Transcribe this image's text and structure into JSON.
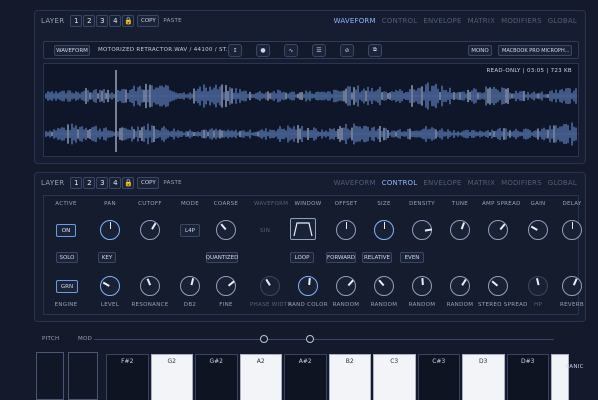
{
  "layer_label": "LAYER",
  "layer_numbers": [
    "1",
    "2",
    "3",
    "4"
  ],
  "copy_label": "COPY",
  "paste_label": "PASTE",
  "tabs": [
    "WAVEFORM",
    "CONTROL",
    "ENVELOPE",
    "MATRIX",
    "MODIFIERS",
    "GLOBAL"
  ],
  "waveform": {
    "button": "WAVEFORM",
    "file": "MOTORIZED RETRACTOR.WAV / 44100 / ST...",
    "mono": "MONO",
    "device": "MACBOOK PRO MICROPH...",
    "readout": "READ-ONLY | 03:05 | 723 KB"
  },
  "control": {
    "top_labels": [
      "ACTIVE",
      "PAN",
      "CUTOFF",
      "MODE",
      "COARSE",
      "WAVEFORM",
      "WINDOW",
      "OFFSET",
      "SIZE",
      "DENSITY",
      "TUNE",
      "AMP SPREAD",
      "GAIN",
      "DELAY"
    ],
    "on": "ON",
    "mode": "L4P",
    "sin": "SIN",
    "solo": "SOLO",
    "key": "KEY",
    "quantized": "QUANTIZED",
    "loop": "LOOP",
    "forward": "FORWARD",
    "relative": "RELATIVE",
    "even": "EVEN",
    "grn": "GRN",
    "bottom_labels": [
      "ENGINE",
      "LEVEL",
      "RESONANCE",
      "DB2",
      "FINE",
      "PHASE WIDTH",
      "RAND COLOR",
      "RANDOM",
      "RANDOM",
      "RANDOM",
      "RANDOM",
      "STEREO SPREAD",
      "HP",
      "REVERB"
    ]
  },
  "pitch_label": "PITCH",
  "mod_label": "MOD",
  "panic_label": "PANIC",
  "keys": [
    "F#2",
    "G2",
    "G#2",
    "A2",
    "A#2",
    "B2",
    "C3",
    "C#3",
    "D3",
    "D#3"
  ]
}
